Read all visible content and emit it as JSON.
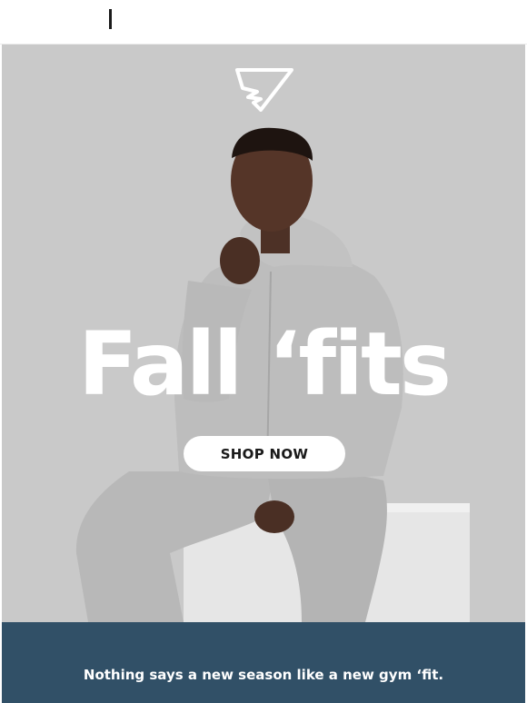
{
  "hero": {
    "headline": "Fall ‘fits",
    "shop_button_label": "SHOP NOW",
    "logo_icon": "shark-logo-icon",
    "background_color": "#c9c9c9"
  },
  "footer": {
    "tagline": "Nothing says a new season like a new gym ‘fit.",
    "background_color": "#315067"
  }
}
